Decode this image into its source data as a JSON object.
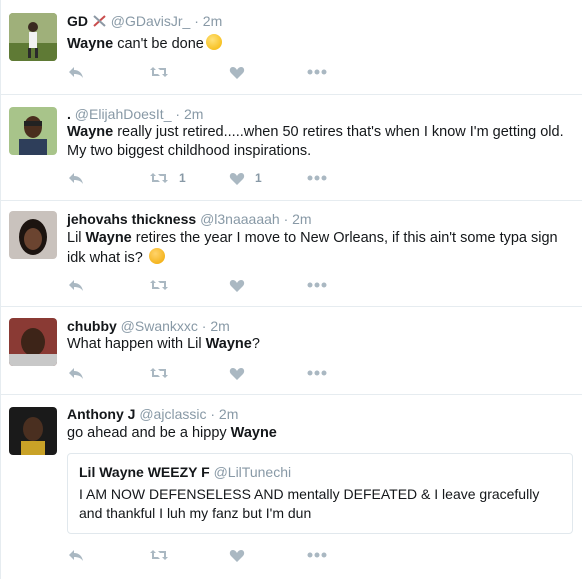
{
  "colors": {
    "name": "#14171a",
    "meta": "#8899a6",
    "action_icon": "#aab8c2",
    "divider": "#e6ecf0"
  },
  "tweets": [
    {
      "name": "GD",
      "name_emoji": "crossed-swords-icon",
      "handle": "@GDavisJr_",
      "dot": "·",
      "time": "2m",
      "text_bold": "Wayne",
      "text_after": " can't be done",
      "emoji": "weary-face-icon",
      "retweets": "",
      "likes": ""
    },
    {
      "name": ".",
      "handle": "@ElijahDoesIt_",
      "dot": "·",
      "time": "2m",
      "text_bold": "Wayne",
      "text_after": " really just retired.....when 50 retires that's when I know I'm getting old. My two biggest childhood inspirations.",
      "retweets": "1",
      "likes": "1"
    },
    {
      "name": "jehovahs thickness",
      "handle": "@l3naaaaah",
      "dot": "·",
      "time": "2m",
      "text_before": "Lil ",
      "text_bold": "Wayne",
      "text_after": " retires the year I move to New Orleans, if this ain't some typa sign idk what is?",
      "emoji": "thinking-face-icon",
      "retweets": "",
      "likes": ""
    },
    {
      "name": "chubby",
      "handle": "@Swankxxc",
      "dot": "·",
      "time": "2m",
      "text_before": "What happen with Lil ",
      "text_bold": "Wayne",
      "text_after": "?",
      "retweets": "",
      "likes": ""
    },
    {
      "name": "Anthony J",
      "handle": "@ajclassic",
      "dot": "·",
      "time": "2m",
      "text_before": "go ahead and be a hippy ",
      "text_bold": "Wayne",
      "text_after": "",
      "quote": {
        "name": "Lil Wayne WEEZY F",
        "handle": "@LilTunechi",
        "text": "I AM NOW DEFENSELESS AND mentally DEFEATED & I leave gracefully and thankful I luh my fanz but I'm dun"
      },
      "retweets": "",
      "likes": ""
    }
  ]
}
